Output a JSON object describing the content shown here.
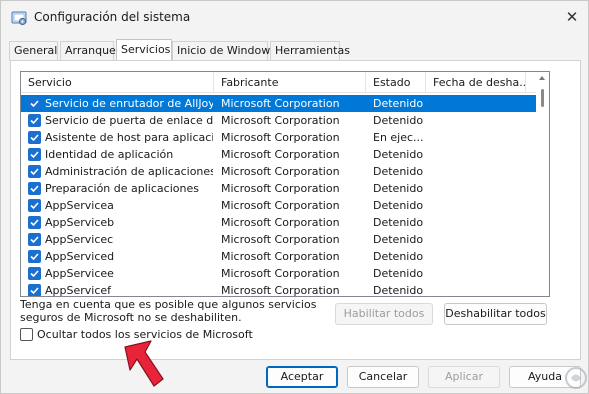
{
  "window": {
    "title": "Configuración del sistema",
    "close_glyph": "✕"
  },
  "tabs": [
    {
      "label": "General",
      "active": false
    },
    {
      "label": "Arranque",
      "active": false
    },
    {
      "label": "Servicios",
      "active": true
    },
    {
      "label": "Inicio de Windows",
      "active": false
    },
    {
      "label": "Herramientas",
      "active": false
    }
  ],
  "services": {
    "columns": [
      "Servicio",
      "Fabricante",
      "Estado",
      "Fecha de desha..."
    ],
    "rows": [
      {
        "name": "Servicio de enrutador de AllJoyn",
        "vendor": "Microsoft Corporation",
        "status": "Detenido",
        "checked": true,
        "selected": true
      },
      {
        "name": "Servicio de puerta de enlace de ...",
        "vendor": "Microsoft Corporation",
        "status": "Detenido",
        "checked": true,
        "selected": false
      },
      {
        "name": "Asistente de host para aplicacio...",
        "vendor": "Microsoft Corporation",
        "status": "En ejec...",
        "checked": true,
        "selected": false
      },
      {
        "name": "Identidad de aplicación",
        "vendor": "Microsoft Corporation",
        "status": "Detenido",
        "checked": true,
        "selected": false
      },
      {
        "name": "Administración de aplicaciones",
        "vendor": "Microsoft Corporation",
        "status": "Detenido",
        "checked": true,
        "selected": false
      },
      {
        "name": "Preparación de aplicaciones",
        "vendor": "Microsoft Corporation",
        "status": "Detenido",
        "checked": true,
        "selected": false
      },
      {
        "name": "AppServicea",
        "vendor": "Microsoft Corporation",
        "status": "Detenido",
        "checked": true,
        "selected": false
      },
      {
        "name": "AppServiceb",
        "vendor": "Microsoft Corporation",
        "status": "Detenido",
        "checked": true,
        "selected": false
      },
      {
        "name": "AppServicec",
        "vendor": "Microsoft Corporation",
        "status": "Detenido",
        "checked": true,
        "selected": false
      },
      {
        "name": "AppServiced",
        "vendor": "Microsoft Corporation",
        "status": "Detenido",
        "checked": true,
        "selected": false
      },
      {
        "name": "AppServicee",
        "vendor": "Microsoft Corporation",
        "status": "Detenido",
        "checked": true,
        "selected": false
      },
      {
        "name": "AppServicef",
        "vendor": "Microsoft Corporation",
        "status": "Detenido",
        "checked": true,
        "selected": false
      }
    ]
  },
  "note": "Tenga en cuenta que es posible que algunos servicios seguros de Microsoft no se deshabiliten.",
  "actions": {
    "enable_all": "Habilitar todos",
    "disable_all": "Deshabilitar todos",
    "hide_ms_label": "Ocultar todos los servicios de Microsoft",
    "hide_ms_checked": false
  },
  "footer": {
    "ok": "Aceptar",
    "cancel": "Cancelar",
    "apply": "Aplicar",
    "help": "Ayuda"
  },
  "colors": {
    "selection": "#0078d7",
    "checkbox": "#1a6fcf",
    "arrow": "#e8243a",
    "default_border": "#0067c0"
  }
}
